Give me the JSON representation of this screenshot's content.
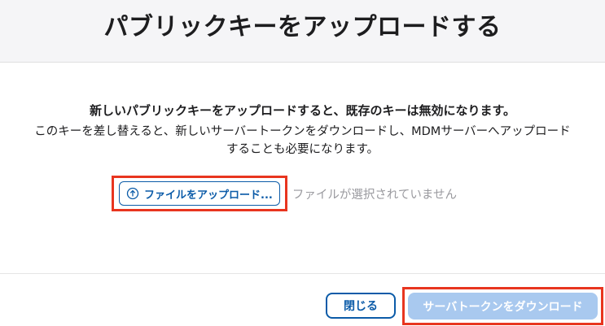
{
  "dialog": {
    "title": "パブリックキーをアップロードする",
    "warning_bold": "新しいパブリックキーをアップロードすると、既存のキーは無効になります。",
    "warning_text": "このキーを差し替えると、新しいサーバートークンをダウンロードし、MDMサーバーへアップロードすることも必要になります。",
    "upload": {
      "button_label": "ファイルをアップロード...",
      "icon": "upload-arrow-circle-icon",
      "file_status": "ファイルが選択されていません"
    },
    "footer": {
      "close_label": "閉じる",
      "download_label": "サーバトークンをダウンロード",
      "download_enabled": false
    },
    "colors": {
      "accent": "#0b5ba8",
      "disabled_button": "#a9c9ef",
      "highlight": "#e8351f",
      "header_bg": "#f5f5f7",
      "muted_text": "#9a9a9f"
    }
  }
}
